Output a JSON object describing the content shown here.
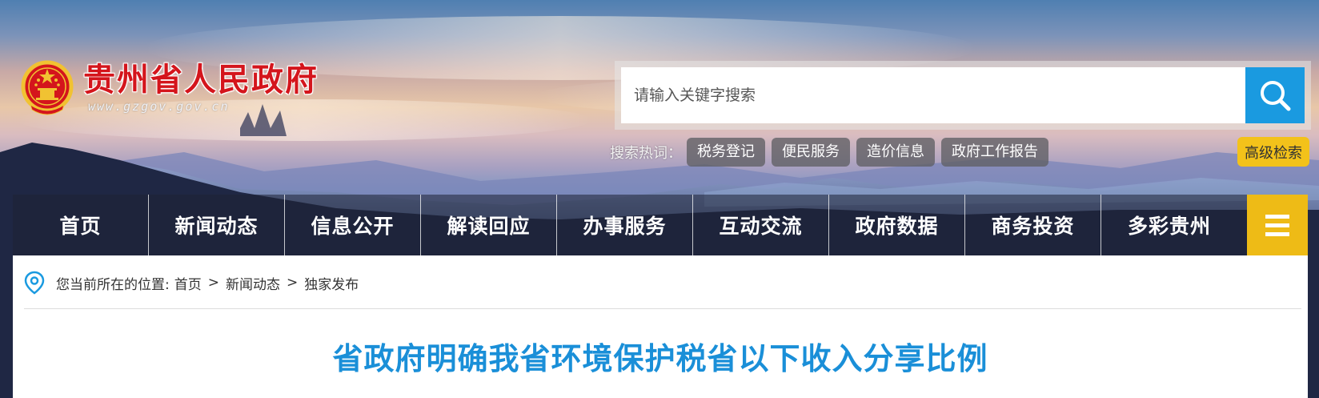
{
  "site": {
    "title": "贵州省人民政府",
    "url": "www.gzgov.gov.cn",
    "emblem_icon": "national-emblem-icon"
  },
  "search": {
    "placeholder": "请输入关键字搜索",
    "value": "",
    "button_icon": "search-icon",
    "hot_label": "搜索热词：",
    "hot_tags": [
      "税务登记",
      "便民服务",
      "造价信息",
      "政府工作报告"
    ],
    "advanced_label": "高级检索"
  },
  "nav": {
    "items": [
      "首页",
      "新闻动态",
      "信息公开",
      "解读回应",
      "办事服务",
      "互动交流",
      "政府数据",
      "商务投资",
      "多彩贵州"
    ],
    "menu_icon": "hamburger-menu-icon"
  },
  "breadcrumb": {
    "icon": "location-pin-icon",
    "prefix": "您当前所在的位置:",
    "items": [
      "首页",
      "新闻动态",
      "独家发布"
    ],
    "separator": ">"
  },
  "article": {
    "title": "省政府明确我省环境保护税省以下收入分享比例"
  },
  "colors": {
    "brand_red": "#d4151c",
    "accent_blue": "#1a9ae0",
    "title_blue": "#1a8fd8",
    "accent_yellow": "#eebb16"
  }
}
